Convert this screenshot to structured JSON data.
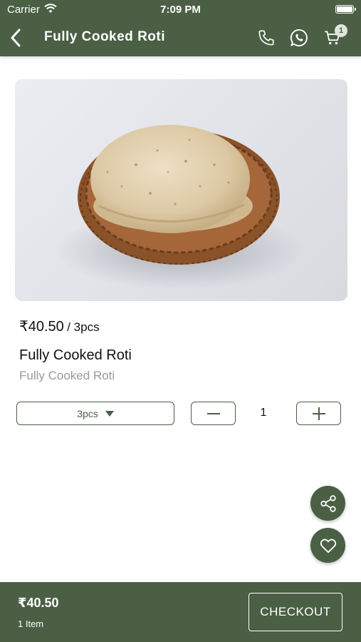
{
  "status_bar": {
    "carrier": "Carrier",
    "time": "7:09 PM"
  },
  "nav": {
    "title": "Fully Cooked Roti",
    "cart_count": "1"
  },
  "product": {
    "image_icon": "roti-basket-photo",
    "price": "₹40.50",
    "per_unit": "/ 3pcs",
    "title": "Fully Cooked Roti",
    "subtitle": "Fully Cooked Roti"
  },
  "controls": {
    "unit_selected": "3pcs",
    "quantity": "1"
  },
  "footer": {
    "total": "₹40.50",
    "item_count": "1 Item",
    "checkout_label": "CHECKOUT"
  },
  "colors": {
    "brand": "#4a5f44",
    "text": "#111111",
    "muted": "#9a9a9a"
  }
}
